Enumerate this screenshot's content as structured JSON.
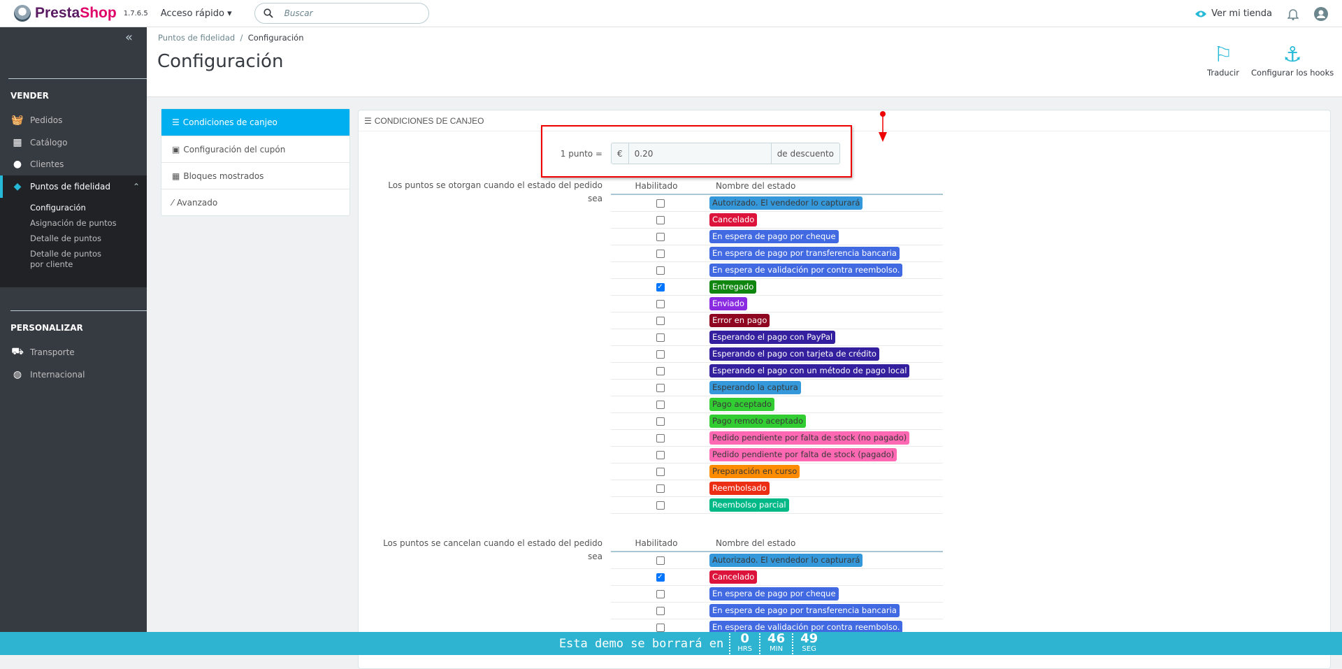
{
  "header": {
    "brand_a": "Presta",
    "brand_b": "Shop",
    "version": "1.7.6.5",
    "quick_access": "Acceso rápido",
    "search_placeholder": "Buscar",
    "view_store": "Ver mi tienda"
  },
  "sidebar": {
    "section1": "VENDER",
    "items1": [
      {
        "label": "Pedidos",
        "icon": "basket-icon"
      },
      {
        "label": "Catálogo",
        "icon": "store-icon"
      },
      {
        "label": "Clientes",
        "icon": "user-icon"
      }
    ],
    "active": {
      "label": "Puntos de fidelidad",
      "icon": "tag-heart-icon"
    },
    "sub": [
      "Configuración",
      "Asignación de puntos",
      "Detalle de puntos",
      "Detalle de puntos por cliente"
    ],
    "section2": "PERSONALIZAR",
    "items2": [
      {
        "label": "Transporte",
        "icon": "truck-icon"
      },
      {
        "label": "Internacional",
        "icon": "globe-icon"
      }
    ]
  },
  "page": {
    "breadcrumb_parent": "Puntos de fidelidad",
    "breadcrumb_current": "Configuración",
    "title": "Configuración",
    "translate": "Traducir",
    "hooks": "Configurar los hooks"
  },
  "tabs": [
    "Condiciones de canjeo",
    "Configuración del cupón",
    "Bloques mostrados",
    "Avanzado"
  ],
  "panel": {
    "heading": "Condiciones de canjeo",
    "point_label": "1 punto =",
    "currency": "€",
    "point_value": "0.20",
    "suffix": "de descuento",
    "col_enabled": "Habilitado",
    "col_name": "Nombre del estado",
    "award_label": "Los puntos se otorgan cuando el estado del pedido sea",
    "cancel_label": "Los puntos se cancelan cuando el estado del pedido sea"
  },
  "statuses": [
    {
      "name": "Autorizado. El vendedor lo capturará",
      "bg": "#3498db",
      "fg": "#383838"
    },
    {
      "name": "Cancelado",
      "bg": "#dc143c",
      "fg": "#ffffff"
    },
    {
      "name": "En espera de pago por cheque",
      "bg": "#4169e1",
      "fg": "#ffffff"
    },
    {
      "name": "En espera de pago por transferencia bancaria",
      "bg": "#4169e1",
      "fg": "#ffffff"
    },
    {
      "name": "En espera de validación por contra reembolso.",
      "bg": "#4169e1",
      "fg": "#ffffff"
    },
    {
      "name": "Entregado",
      "bg": "#108510",
      "fg": "#ffffff"
    },
    {
      "name": "Enviado",
      "bg": "#8a2be2",
      "fg": "#ffffff"
    },
    {
      "name": "Error en pago",
      "bg": "#8f0621",
      "fg": "#ffffff"
    },
    {
      "name": "Esperando el pago con PayPal",
      "bg": "#34209e",
      "fg": "#ffffff"
    },
    {
      "name": "Esperando el pago con tarjeta de crédito",
      "bg": "#34209e",
      "fg": "#ffffff"
    },
    {
      "name": "Esperando el pago con un método de pago local",
      "bg": "#34209e",
      "fg": "#ffffff"
    },
    {
      "name": "Esperando la captura",
      "bg": "#3498db",
      "fg": "#383838"
    },
    {
      "name": "Pago aceptado",
      "bg": "#32cd32",
      "fg": "#383838"
    },
    {
      "name": "Pago remoto aceptado",
      "bg": "#32cd32",
      "fg": "#383838"
    },
    {
      "name": "Pedido pendiente por falta de stock (no pagado)",
      "bg": "#ff69b4",
      "fg": "#383838"
    },
    {
      "name": "Pedido pendiente por falta de stock (pagado)",
      "bg": "#ff69b4",
      "fg": "#383838"
    },
    {
      "name": "Preparación en curso",
      "bg": "#ff8c00",
      "fg": "#383838"
    },
    {
      "name": "Reembolsado",
      "bg": "#ec2e15",
      "fg": "#ffffff"
    },
    {
      "name": "Reembolso parcial",
      "bg": "#01b887",
      "fg": "#ffffff"
    }
  ],
  "award_checked": [
    false,
    false,
    false,
    false,
    false,
    true,
    false,
    false,
    false,
    false,
    false,
    false,
    false,
    false,
    false,
    false,
    false,
    false,
    false
  ],
  "cancel_checked": [
    false,
    true,
    false,
    false,
    false
  ],
  "footer": {
    "message": "Esta demo se borrará en",
    "hours": "0",
    "hours_label": "HRS",
    "minutes": "46",
    "minutes_label": "MIN",
    "seconds": "49",
    "seconds_label": "SEG"
  }
}
